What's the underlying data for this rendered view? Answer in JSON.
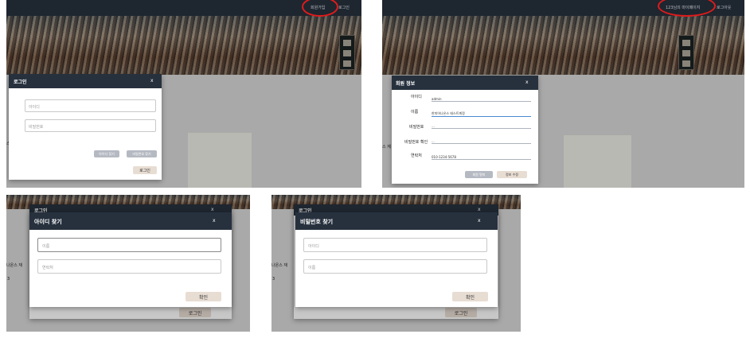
{
  "panel_login": {
    "nav": {
      "signup": "회원가입",
      "login": "로그인"
    },
    "side_text": "스 재",
    "modal": {
      "title": "로그인",
      "close": "x",
      "id_placeholder": "아이디",
      "pw_placeholder": "비밀번호",
      "find_id": "아이디 찾기",
      "find_pw": "비밀번호 찾기",
      "submit": "로그인"
    }
  },
  "panel_profile": {
    "nav": {
      "mypage": "123님의 마이페이지",
      "logout": "로그아웃"
    },
    "side_text": "스 재",
    "modal": {
      "title": "회원 정보",
      "close": "x",
      "fields": [
        {
          "label": "아이디",
          "value": "admin"
        },
        {
          "label": "이름",
          "value": "한미어나온스 테스트계정"
        },
        {
          "label": "비밀번호",
          "value": "..."
        },
        {
          "label": "비밀번호 확인",
          "value": "..."
        },
        {
          "label": "연락처",
          "value": "010-1234-5678"
        }
      ],
      "withdraw": "회원 탈퇴",
      "edit": "정보 수정"
    }
  },
  "panel_find_id": {
    "behind_title": "로그인",
    "behind_close": "x",
    "behind_button": "로그인",
    "side_text": "나온스 재",
    "side_text2": "3",
    "modal": {
      "title": "아이디 찾기",
      "close": "x",
      "name_placeholder": "이름",
      "phone_placeholder": "연락처",
      "confirm": "확인"
    }
  },
  "panel_find_pw": {
    "behind_title": "로그인",
    "behind_close": "x",
    "behind_button": "로그인",
    "side_text": "나온스 재",
    "side_text2": "3",
    "modal": {
      "title": "비밀번호 찾기",
      "close": "x",
      "id_placeholder": "아이디",
      "name_placeholder": "이름",
      "confirm": "확인"
    }
  },
  "colors": {
    "header": "#27313e",
    "highlight": "#e01b1b",
    "beige_button": "#e8ddd3",
    "gray_button": "#b5b9c2"
  }
}
